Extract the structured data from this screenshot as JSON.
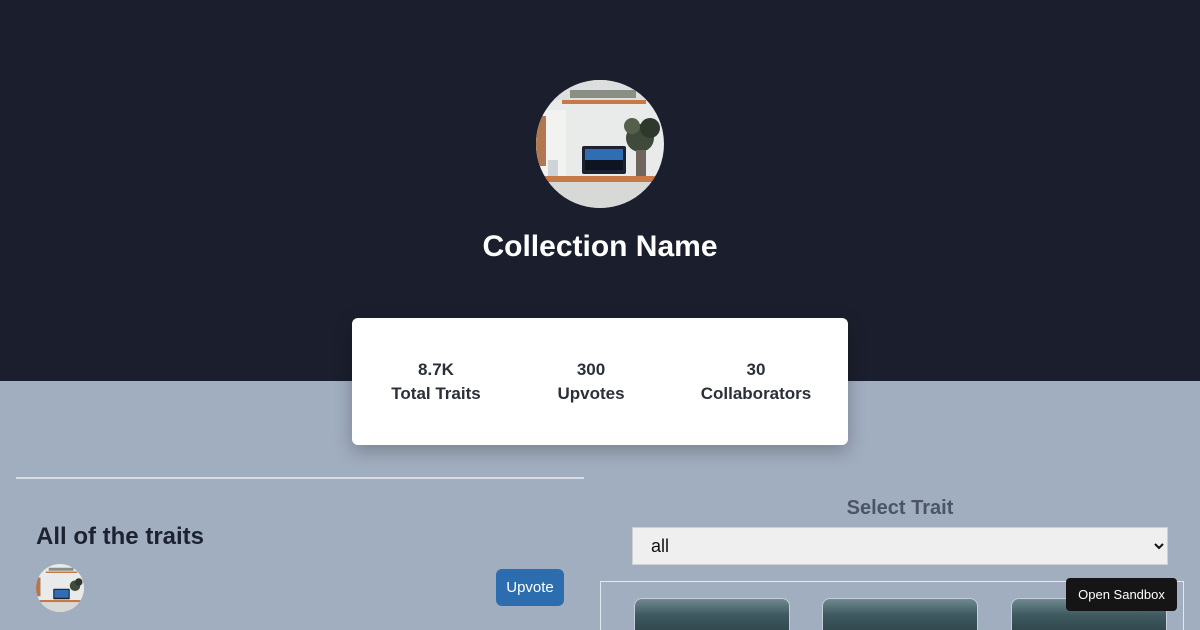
{
  "collection": {
    "name": "Collection Name"
  },
  "stats": [
    {
      "value": "8.7K",
      "label": "Total Traits"
    },
    {
      "value": "300",
      "label": "Upvotes"
    },
    {
      "value": "30",
      "label": "Collaborators"
    }
  ],
  "traits_section": {
    "title": "All of the traits",
    "upvote_label": "Upvote"
  },
  "trait_filter": {
    "label": "Select Trait",
    "selected": "all"
  },
  "sandbox": {
    "label": "Open Sandbox"
  },
  "colors": {
    "hero_bg": "#1b1f2d",
    "page_bg": "#a1aec0",
    "accent": "#2c6db0"
  }
}
